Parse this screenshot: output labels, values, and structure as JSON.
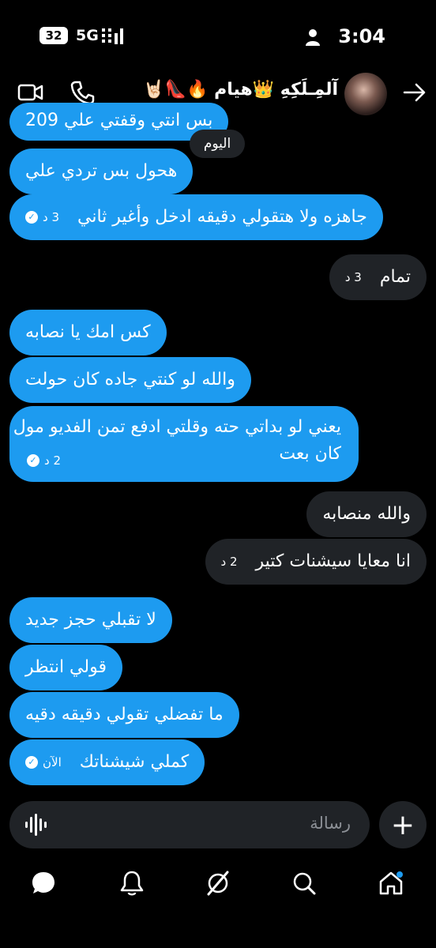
{
  "status_bar": {
    "battery": "32",
    "network": "5G",
    "time": "3:04"
  },
  "header": {
    "title": "آلمِـلَكِهِ 👑هيام 🔥👠🤘🏻",
    "icons": [
      "back-arrow-icon",
      "phone-icon",
      "video-call-icon"
    ]
  },
  "messages": [
    {
      "side": "out",
      "text": "بس انتي وقفتي علي 209"
    },
    {
      "side": "out",
      "text": "هحول بس تردي علي"
    },
    {
      "side": "out",
      "text": "جاهزه ولا هتقولي دقيقه ادخل وأغير ثاني",
      "time": "3 د",
      "seen": true
    },
    {
      "side": "in",
      "text": "تمام",
      "time": "3 د"
    },
    {
      "side": "out",
      "text": "كس امك يا نصابه"
    },
    {
      "side": "out",
      "text": "والله لو كنتي جاده كان حولت"
    },
    {
      "side": "out",
      "text": "يعني لو بداتي حته وقلتي ادفع تمن الفديو مول",
      "text2": "كان بعت",
      "time": "2 د",
      "seen": true
    },
    {
      "side": "in",
      "text": "والله منصابه"
    },
    {
      "side": "in",
      "text": "انا معايا سيشنات كتير",
      "time": "2 د"
    },
    {
      "side": "out",
      "text": "لا تقبلي حجز جديد"
    },
    {
      "side": "out",
      "text": "قولي انتظر"
    },
    {
      "side": "out",
      "text": "ما تفضلي تقولي دقيقه دقيه"
    },
    {
      "side": "out",
      "text": "كملي شيشناتك",
      "time": "الآن",
      "seen": true
    }
  ],
  "date_divider": "اليوم",
  "composer": {
    "placeholder": "رسالة"
  },
  "bottom_nav": [
    "home-icon",
    "search-icon",
    "grok-icon",
    "notifications-icon",
    "messages-icon"
  ],
  "colors": {
    "accent": "#1d9bf0",
    "incoming_bubble": "#202327",
    "background": "#000000"
  }
}
